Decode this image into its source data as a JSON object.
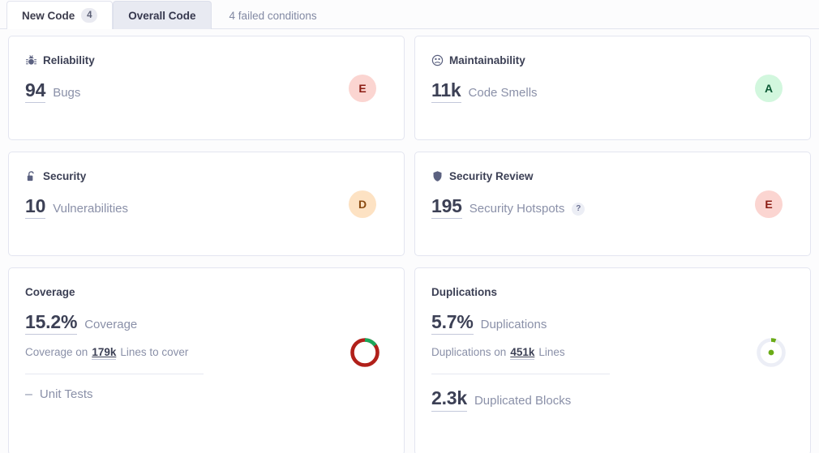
{
  "tabs": [
    {
      "label": "New Code",
      "badge": "4",
      "selected": false
    },
    {
      "label": "Overall Code",
      "badge": "",
      "selected": true
    }
  ],
  "failed_conditions": "4 failed conditions",
  "cards": {
    "reliability": {
      "title": "Reliability",
      "icon": "bug-icon",
      "value": "94",
      "label": "Bugs",
      "rating": "E",
      "rating_bg": "#fbd5d1",
      "rating_fg": "#8b1c13"
    },
    "maintainability": {
      "title": "Maintainability",
      "icon": "code-smell-icon",
      "value": "11k",
      "label": "Code Smells",
      "rating": "A",
      "rating_bg": "#d2f7de",
      "rating_fg": "#0c5a35"
    },
    "security": {
      "title": "Security",
      "icon": "lock-icon",
      "value": "10",
      "label": "Vulnerabilities",
      "rating": "D",
      "rating_bg": "#fde2c3",
      "rating_fg": "#8a4a10"
    },
    "security_review": {
      "title": "Security Review",
      "icon": "shield-icon",
      "value": "195",
      "label": "Security Hotspots",
      "help_badge": "?",
      "rating": "E",
      "rating_bg": "#fbd5d1",
      "rating_fg": "#8b1c13"
    },
    "coverage": {
      "title": "Coverage",
      "value": "15.2%",
      "label": "Coverage",
      "sub_prefix": "Coverage on",
      "sub_value": "179k",
      "sub_suffix": "Lines to cover",
      "footer_dash": "–",
      "footer_label": "Unit Tests"
    },
    "duplications": {
      "title": "Duplications",
      "value": "5.7%",
      "label": "Duplications",
      "sub_prefix": "Duplications on",
      "sub_value": "451k",
      "sub_suffix": "Lines",
      "footer_value": "2.3k",
      "footer_label": "Duplicated Blocks"
    }
  },
  "chart_data": [
    {
      "type": "pie",
      "title": "Coverage",
      "categories": [
        "Covered",
        "Uncovered"
      ],
      "values": [
        15.2,
        84.8
      ],
      "colors": [
        "#1ca75b",
        "#b1201a"
      ]
    },
    {
      "type": "pie",
      "title": "Duplications",
      "categories": [
        "Duplicated",
        "Not duplicated"
      ],
      "values": [
        5.7,
        94.3
      ],
      "colors": [
        "#6aab16",
        "#eceef6"
      ]
    }
  ]
}
